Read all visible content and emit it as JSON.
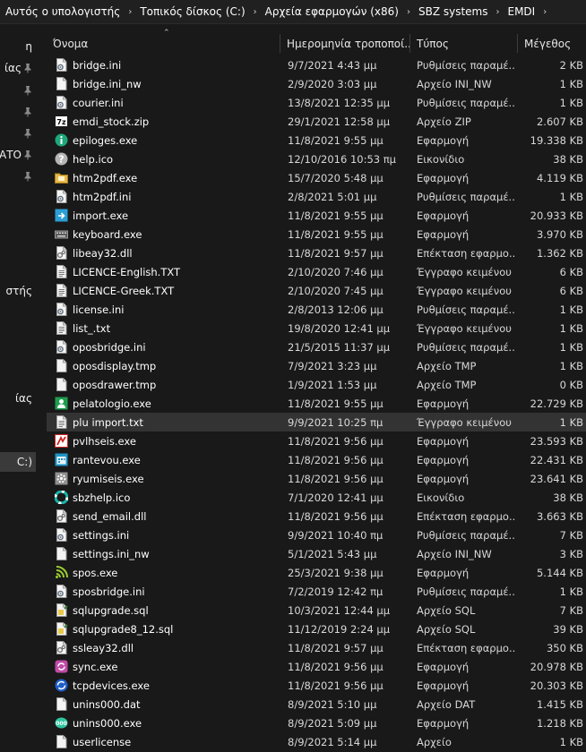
{
  "breadcrumb": [
    {
      "label": "Αυτός ο υπολογιστής"
    },
    {
      "label": "Τοπικός δίσκος (C:)"
    },
    {
      "label": "Αρχεία εφαρμογών (x86)"
    },
    {
      "label": "SBZ systems"
    },
    {
      "label": "EMDI"
    }
  ],
  "nav": {
    "items": [
      {
        "label": "η",
        "pinned": false
      },
      {
        "label": "ίας",
        "pinned": true
      },
      {
        "label": "",
        "pinned": true
      },
      {
        "label": "",
        "pinned": true
      },
      {
        "label": "",
        "pinned": true
      },
      {
        "label": "ΛΑΤΟ",
        "pinned": true
      },
      {
        "label": "",
        "pinned": true
      },
      {
        "label": "στής",
        "pinned": false
      },
      {
        "label": "ίας",
        "pinned": false
      },
      {
        "label": "C:)",
        "pinned": false
      }
    ]
  },
  "columns": {
    "name": "Όνομα",
    "date": "Ημερομηνία τροποποί...",
    "type": "Τύπος",
    "size": "Μέγεθος"
  },
  "colors": {
    "background": "#191919",
    "hover_row": "#333333",
    "text": "#ffffff"
  },
  "files": [
    {
      "name": "bridge.ini",
      "date": "9/7/2021 4:43 μμ",
      "type": "Ρυθμίσεις παραμέ...",
      "size": "2 KB",
      "icon": "settings-file-icon"
    },
    {
      "name": "bridge.ini_nw",
      "date": "2/9/2020 3:03 μμ",
      "type": "Αρχείο INI_NW",
      "size": "1 KB",
      "icon": "blank-file-icon"
    },
    {
      "name": "courier.ini",
      "date": "13/8/2021 12:35 μμ",
      "type": "Ρυθμίσεις παραμέ...",
      "size": "1 KB",
      "icon": "settings-file-icon"
    },
    {
      "name": "emdi_stock.zip",
      "date": "29/1/2021 12:58 μμ",
      "type": "Αρχείο ZIP",
      "size": "2.607 KB",
      "icon": "zip-icon"
    },
    {
      "name": "epiloges.exe",
      "date": "11/8/2021 9:55 μμ",
      "type": "Εφαρμογή",
      "size": "19.338 KB",
      "icon": "green-circle-app-icon"
    },
    {
      "name": "help.ico",
      "date": "12/10/2016 10:53 πμ",
      "type": "Εικονίδιο",
      "size": "38 KB",
      "icon": "help-icon"
    },
    {
      "name": "htm2pdf.exe",
      "date": "15/7/2020 5:48 μμ",
      "type": "Εφαρμογή",
      "size": "4.119 KB",
      "icon": "folder-app-icon"
    },
    {
      "name": "htm2pdf.ini",
      "date": "2/8/2021 5:01 μμ",
      "type": "Ρυθμίσεις παραμέ...",
      "size": "1 KB",
      "icon": "settings-file-icon"
    },
    {
      "name": "import.exe",
      "date": "11/8/2021 9:55 μμ",
      "type": "Εφαρμογή",
      "size": "20.933 KB",
      "icon": "import-app-icon"
    },
    {
      "name": "keyboard.exe",
      "date": "11/8/2021 9:55 μμ",
      "type": "Εφαρμογή",
      "size": "3.970 KB",
      "icon": "keyboard-icon"
    },
    {
      "name": "libeay32.dll",
      "date": "11/8/2021 9:57 μμ",
      "type": "Επέκταση εφαρμο...",
      "size": "1.362 KB",
      "icon": "dll-icon"
    },
    {
      "name": "LICENCE-English.TXT",
      "date": "2/10/2020 7:46 μμ",
      "type": "Έγγραφο κειμένου",
      "size": "6 KB",
      "icon": "text-file-icon"
    },
    {
      "name": "LICENCE-Greek.TXT",
      "date": "2/10/2020 7:45 μμ",
      "type": "Έγγραφο κειμένου",
      "size": "6 KB",
      "icon": "text-file-icon"
    },
    {
      "name": "license.ini",
      "date": "2/8/2013 12:06 μμ",
      "type": "Ρυθμίσεις παραμέ...",
      "size": "1 KB",
      "icon": "settings-file-icon"
    },
    {
      "name": "list_.txt",
      "date": "19/8/2020 12:41 μμ",
      "type": "Έγγραφο κειμένου",
      "size": "1 KB",
      "icon": "text-file-icon"
    },
    {
      "name": "oposbridge.ini",
      "date": "21/5/2015 11:37 μμ",
      "type": "Ρυθμίσεις παραμέ...",
      "size": "1 KB",
      "icon": "settings-file-icon"
    },
    {
      "name": "oposdisplay.tmp",
      "date": "7/9/2021 3:23 μμ",
      "type": "Αρχείο TMP",
      "size": "1 KB",
      "icon": "blank-file-icon"
    },
    {
      "name": "oposdrawer.tmp",
      "date": "1/9/2021 1:53 μμ",
      "type": "Αρχείο TMP",
      "size": "0 KB",
      "icon": "blank-file-icon"
    },
    {
      "name": "pelatologio.exe",
      "date": "11/8/2021 9:55 μμ",
      "type": "Εφαρμογή",
      "size": "22.729 KB",
      "icon": "contacts-app-icon"
    },
    {
      "name": "plu import.txt",
      "date": "9/9/2021 10:25 πμ",
      "type": "Έγγραφο κειμένου",
      "size": "1 KB",
      "icon": "text-file-icon"
    },
    {
      "name": "pvlhseis.exe",
      "date": "11/8/2021 9:56 μμ",
      "type": "Εφαρμογή",
      "size": "23.593 KB",
      "icon": "sales-app-icon"
    },
    {
      "name": "rantevou.exe",
      "date": "11/8/2021 9:56 μμ",
      "type": "Εφαρμογή",
      "size": "22.431 KB",
      "icon": "calendar-app-icon"
    },
    {
      "name": "ryumiseis.exe",
      "date": "11/8/2021 9:56 μμ",
      "type": "Εφαρμογή",
      "size": "23.641 KB",
      "icon": "gear-app-icon"
    },
    {
      "name": "sbzhelp.ico",
      "date": "7/1/2020 12:41 μμ",
      "type": "Εικονίδιο",
      "size": "38 KB",
      "icon": "lifebuoy-icon"
    },
    {
      "name": "send_email.dll",
      "date": "11/8/2021 9:56 μμ",
      "type": "Επέκταση εφαρμο...",
      "size": "3.663 KB",
      "icon": "dll-icon"
    },
    {
      "name": "settings.ini",
      "date": "9/9/2021 10:40 πμ",
      "type": "Ρυθμίσεις παραμέ...",
      "size": "7 KB",
      "icon": "settings-file-icon"
    },
    {
      "name": "settings.ini_nw",
      "date": "5/1/2021 5:43 μμ",
      "type": "Αρχείο INI_NW",
      "size": "3 KB",
      "icon": "blank-file-icon"
    },
    {
      "name": "spos.exe",
      "date": "25/3/2021 9:38 μμ",
      "type": "Εφαρμογή",
      "size": "5.144 KB",
      "icon": "wifi-app-icon"
    },
    {
      "name": "sposbridge.ini",
      "date": "7/2/2019 12:42 πμ",
      "type": "Ρυθμίσεις παραμέ...",
      "size": "1 KB",
      "icon": "settings-file-icon"
    },
    {
      "name": "sqlupgrade.sql",
      "date": "10/3/2021 12:44 μμ",
      "type": "Αρχείο SQL",
      "size": "7 KB",
      "icon": "sql-file-icon"
    },
    {
      "name": "sqlupgrade8_12.sql",
      "date": "11/12/2019 2:24 μμ",
      "type": "Αρχείο SQL",
      "size": "39 KB",
      "icon": "sql-file-icon"
    },
    {
      "name": "ssleay32.dll",
      "date": "11/8/2021 9:57 μμ",
      "type": "Επέκταση εφαρμο...",
      "size": "350 KB",
      "icon": "dll-icon"
    },
    {
      "name": "sync.exe",
      "date": "11/8/2021 9:56 μμ",
      "type": "Εφαρμογή",
      "size": "20.978 KB",
      "icon": "sync-app-icon"
    },
    {
      "name": "tcpdevices.exe",
      "date": "11/8/2021 9:56 μμ",
      "type": "Εφαρμογή",
      "size": "20.303 KB",
      "icon": "network-app-icon"
    },
    {
      "name": "unins000.dat",
      "date": "8/9/2021 5:10 μμ",
      "type": "Αρχείο DAT",
      "size": "1.415 KB",
      "icon": "blank-file-icon"
    },
    {
      "name": "unins000.exe",
      "date": "8/9/2021 5:09 μμ",
      "type": "Εφαρμογή",
      "size": "1.218 KB",
      "icon": "uninstaller-icon"
    },
    {
      "name": "userlicense",
      "date": "8/9/2021 5:14 μμ",
      "type": "Αρχείο",
      "size": "1 KB",
      "icon": "blank-file-icon"
    }
  ],
  "hover_index": 19
}
